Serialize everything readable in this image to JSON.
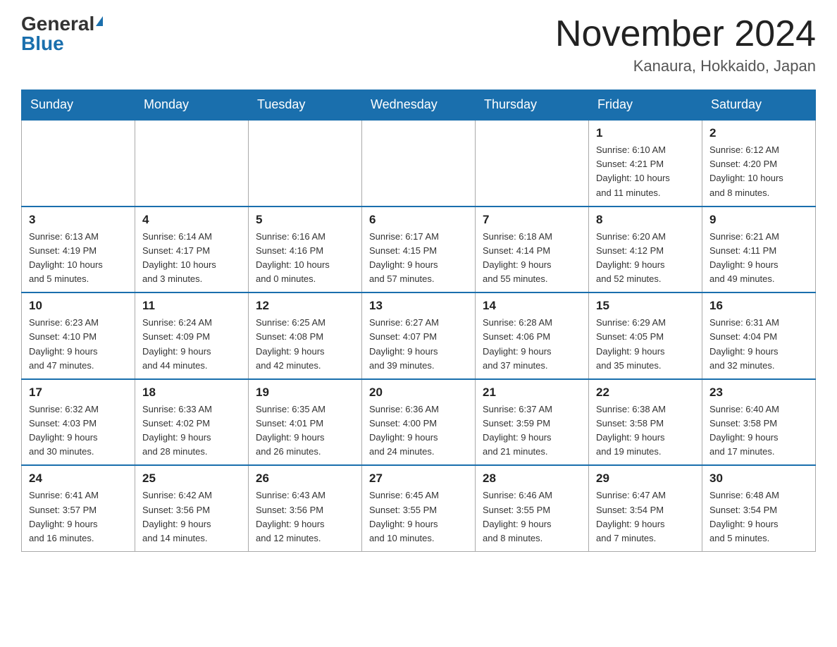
{
  "header": {
    "logo_general": "General",
    "logo_blue": "Blue",
    "month_title": "November 2024",
    "location": "Kanaura, Hokkaido, Japan"
  },
  "weekdays": [
    "Sunday",
    "Monday",
    "Tuesday",
    "Wednesday",
    "Thursday",
    "Friday",
    "Saturday"
  ],
  "weeks": [
    [
      {
        "day": "",
        "info": ""
      },
      {
        "day": "",
        "info": ""
      },
      {
        "day": "",
        "info": ""
      },
      {
        "day": "",
        "info": ""
      },
      {
        "day": "",
        "info": ""
      },
      {
        "day": "1",
        "info": "Sunrise: 6:10 AM\nSunset: 4:21 PM\nDaylight: 10 hours\nand 11 minutes."
      },
      {
        "day": "2",
        "info": "Sunrise: 6:12 AM\nSunset: 4:20 PM\nDaylight: 10 hours\nand 8 minutes."
      }
    ],
    [
      {
        "day": "3",
        "info": "Sunrise: 6:13 AM\nSunset: 4:19 PM\nDaylight: 10 hours\nand 5 minutes."
      },
      {
        "day": "4",
        "info": "Sunrise: 6:14 AM\nSunset: 4:17 PM\nDaylight: 10 hours\nand 3 minutes."
      },
      {
        "day": "5",
        "info": "Sunrise: 6:16 AM\nSunset: 4:16 PM\nDaylight: 10 hours\nand 0 minutes."
      },
      {
        "day": "6",
        "info": "Sunrise: 6:17 AM\nSunset: 4:15 PM\nDaylight: 9 hours\nand 57 minutes."
      },
      {
        "day": "7",
        "info": "Sunrise: 6:18 AM\nSunset: 4:14 PM\nDaylight: 9 hours\nand 55 minutes."
      },
      {
        "day": "8",
        "info": "Sunrise: 6:20 AM\nSunset: 4:12 PM\nDaylight: 9 hours\nand 52 minutes."
      },
      {
        "day": "9",
        "info": "Sunrise: 6:21 AM\nSunset: 4:11 PM\nDaylight: 9 hours\nand 49 minutes."
      }
    ],
    [
      {
        "day": "10",
        "info": "Sunrise: 6:23 AM\nSunset: 4:10 PM\nDaylight: 9 hours\nand 47 minutes."
      },
      {
        "day": "11",
        "info": "Sunrise: 6:24 AM\nSunset: 4:09 PM\nDaylight: 9 hours\nand 44 minutes."
      },
      {
        "day": "12",
        "info": "Sunrise: 6:25 AM\nSunset: 4:08 PM\nDaylight: 9 hours\nand 42 minutes."
      },
      {
        "day": "13",
        "info": "Sunrise: 6:27 AM\nSunset: 4:07 PM\nDaylight: 9 hours\nand 39 minutes."
      },
      {
        "day": "14",
        "info": "Sunrise: 6:28 AM\nSunset: 4:06 PM\nDaylight: 9 hours\nand 37 minutes."
      },
      {
        "day": "15",
        "info": "Sunrise: 6:29 AM\nSunset: 4:05 PM\nDaylight: 9 hours\nand 35 minutes."
      },
      {
        "day": "16",
        "info": "Sunrise: 6:31 AM\nSunset: 4:04 PM\nDaylight: 9 hours\nand 32 minutes."
      }
    ],
    [
      {
        "day": "17",
        "info": "Sunrise: 6:32 AM\nSunset: 4:03 PM\nDaylight: 9 hours\nand 30 minutes."
      },
      {
        "day": "18",
        "info": "Sunrise: 6:33 AM\nSunset: 4:02 PM\nDaylight: 9 hours\nand 28 minutes."
      },
      {
        "day": "19",
        "info": "Sunrise: 6:35 AM\nSunset: 4:01 PM\nDaylight: 9 hours\nand 26 minutes."
      },
      {
        "day": "20",
        "info": "Sunrise: 6:36 AM\nSunset: 4:00 PM\nDaylight: 9 hours\nand 24 minutes."
      },
      {
        "day": "21",
        "info": "Sunrise: 6:37 AM\nSunset: 3:59 PM\nDaylight: 9 hours\nand 21 minutes."
      },
      {
        "day": "22",
        "info": "Sunrise: 6:38 AM\nSunset: 3:58 PM\nDaylight: 9 hours\nand 19 minutes."
      },
      {
        "day": "23",
        "info": "Sunrise: 6:40 AM\nSunset: 3:58 PM\nDaylight: 9 hours\nand 17 minutes."
      }
    ],
    [
      {
        "day": "24",
        "info": "Sunrise: 6:41 AM\nSunset: 3:57 PM\nDaylight: 9 hours\nand 16 minutes."
      },
      {
        "day": "25",
        "info": "Sunrise: 6:42 AM\nSunset: 3:56 PM\nDaylight: 9 hours\nand 14 minutes."
      },
      {
        "day": "26",
        "info": "Sunrise: 6:43 AM\nSunset: 3:56 PM\nDaylight: 9 hours\nand 12 minutes."
      },
      {
        "day": "27",
        "info": "Sunrise: 6:45 AM\nSunset: 3:55 PM\nDaylight: 9 hours\nand 10 minutes."
      },
      {
        "day": "28",
        "info": "Sunrise: 6:46 AM\nSunset: 3:55 PM\nDaylight: 9 hours\nand 8 minutes."
      },
      {
        "day": "29",
        "info": "Sunrise: 6:47 AM\nSunset: 3:54 PM\nDaylight: 9 hours\nand 7 minutes."
      },
      {
        "day": "30",
        "info": "Sunrise: 6:48 AM\nSunset: 3:54 PM\nDaylight: 9 hours\nand 5 minutes."
      }
    ]
  ]
}
